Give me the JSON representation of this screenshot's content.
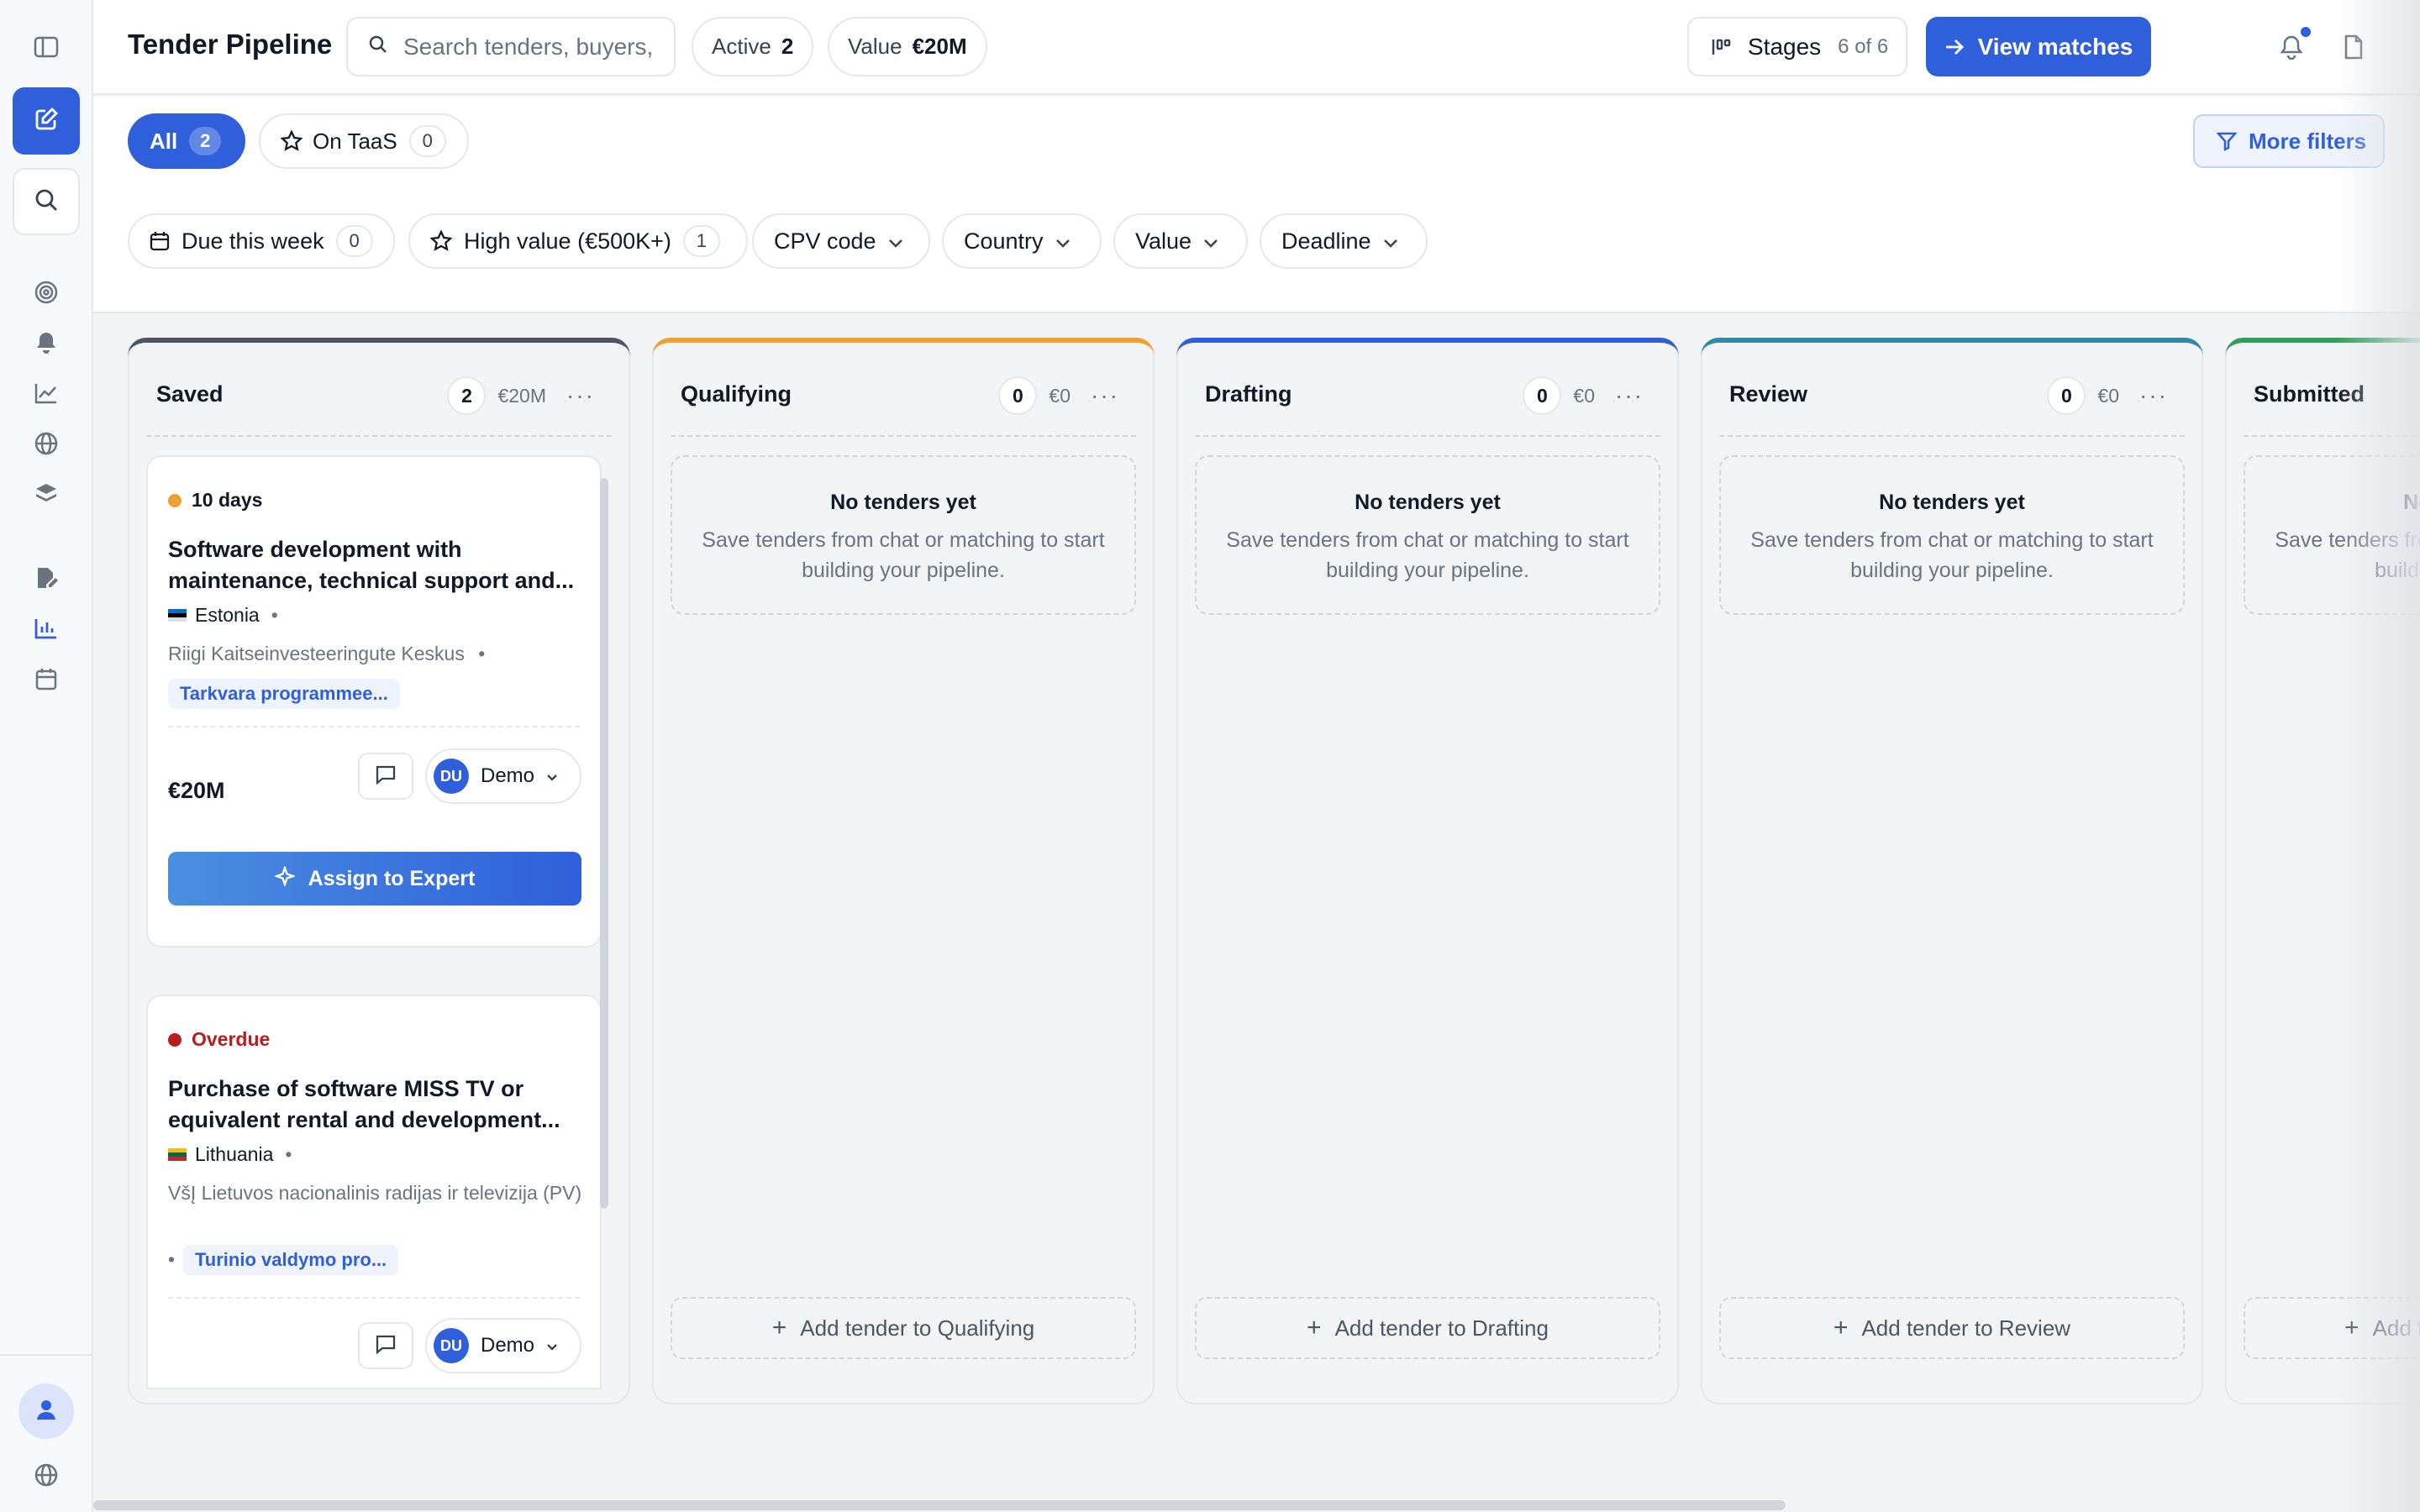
{
  "header": {
    "title": "Tender Pipeline",
    "search_placeholder": "Search tenders, buyers, CPV...",
    "active_label": "Active",
    "active_count": "2",
    "value_label": "Value",
    "value_amount": "€20M",
    "stages_label": "Stages",
    "stages_count": "6 of 6",
    "view_matches_label": "View matches"
  },
  "filters": {
    "tabs": [
      {
        "label": "All",
        "count": "2"
      },
      {
        "label": "On TaaS",
        "count": "0"
      }
    ],
    "more_filters_label": "More filters",
    "quick": [
      {
        "label": "Due this week",
        "count": "0"
      },
      {
        "label": "High value (€500K+)",
        "count": "1"
      }
    ],
    "dropdowns": [
      "CPV code",
      "Country",
      "Value",
      "Deadline"
    ]
  },
  "columns": [
    {
      "title": "Saved",
      "count": "2",
      "value": "€20M",
      "color": "#4b5563"
    },
    {
      "title": "Qualifying",
      "count": "0",
      "value": "€0",
      "color": "#f0a030",
      "add_label": "Add tender to Qualifying"
    },
    {
      "title": "Drafting",
      "count": "0",
      "value": "€0",
      "color": "#2f5fdb",
      "add_label": "Add tender to Drafting"
    },
    {
      "title": "Review",
      "count": "0",
      "value": "€0",
      "color": "#2f8aa8",
      "add_label": "Add tender to Review"
    },
    {
      "title": "Submitted",
      "count": "",
      "value": "",
      "color": "#2f9e5a",
      "add_label": "Add tender to Submitted"
    }
  ],
  "empty_state": {
    "title": "No tenders yet",
    "subtitle": "Save tenders from chat or matching to start building your pipeline."
  },
  "cards": [
    {
      "due": "10 days",
      "due_color": "#f0a030",
      "title": "Software development with maintenance, technical support and...",
      "country": "Estonia",
      "buyer": "Riigi Kaitseinvesteeringute Keskus",
      "cpv": "Tarkvara programmee...",
      "value": "€20M",
      "owner_initials": "DU",
      "owner_name": "Demo",
      "assign_label": "Assign to Expert"
    },
    {
      "due": "Overdue",
      "due_color": "#b91c1c",
      "title": "Purchase of software MISS TV or equivalent rental and development...",
      "country": "Lithuania",
      "buyer": "VšĮ Lietuvos nacionalinis radijas ir televizija (PV)",
      "cpv": "Turinio valdymo pro...",
      "owner_initials": "DU",
      "owner_name": "Demo"
    }
  ],
  "icons": {
    "sidebar": [
      "sidebar-toggle-icon",
      "edit-icon",
      "search-icon",
      "target-icon",
      "bell-icon",
      "trend-icon",
      "globe-icon",
      "layers-icon",
      "document-edit-icon",
      "bar-chart-icon",
      "calendar-icon",
      "user-icon",
      "globe-icon"
    ],
    "header": [
      "search-icon",
      "kanban-icon",
      "arrow-right-icon",
      "bell-icon",
      "document-icon"
    ]
  },
  "colors": {
    "accent": "#2f5fdb",
    "overdue": "#b91c1c",
    "warning": "#f0a030"
  }
}
